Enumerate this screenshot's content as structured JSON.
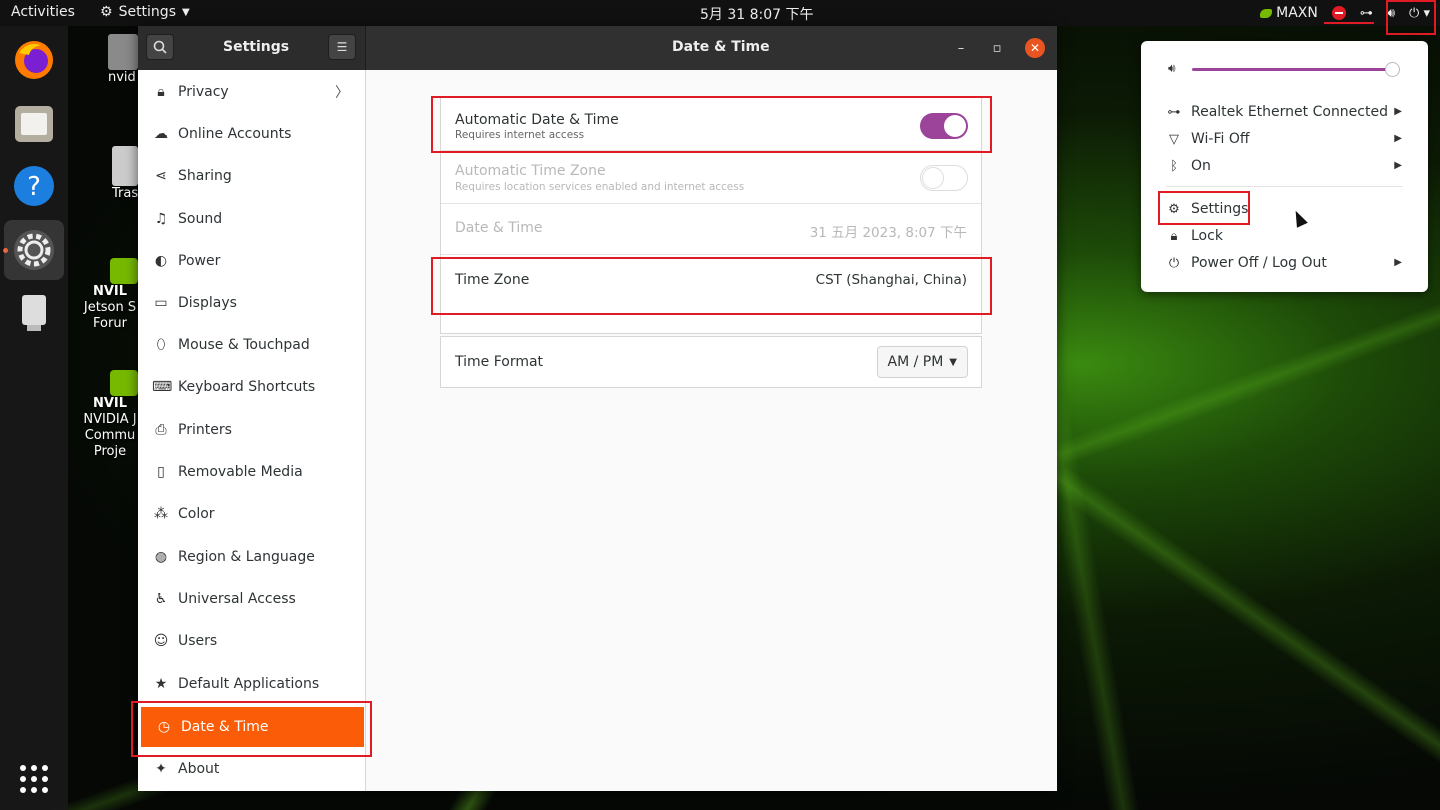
{
  "topbar": {
    "activities": "Activities",
    "app_menu": "Settings",
    "clock": "5月 31  8:07 下午",
    "power_mode": "MAXN"
  },
  "desktop": {
    "home_label": "nvid",
    "trash_label": "Tras",
    "nvidia1_label": [
      "NVIL",
      "Jetson S",
      "Forur"
    ],
    "nvidia2_label": [
      "NVIL",
      "NVIDIA J",
      "Commu",
      "Proje"
    ]
  },
  "window": {
    "sidebar_title": "Settings",
    "page_title": "Date & Time"
  },
  "sidebar": {
    "items": [
      {
        "label": "Privacy",
        "icon": "lock-icon"
      },
      {
        "label": "Online Accounts",
        "icon": "cloud-icon"
      },
      {
        "label": "Sharing",
        "icon": "share-icon"
      },
      {
        "label": "Sound",
        "icon": "music-note-icon"
      },
      {
        "label": "Power",
        "icon": "power-icon"
      },
      {
        "label": "Displays",
        "icon": "display-icon"
      },
      {
        "label": "Mouse & Touchpad",
        "icon": "mouse-icon"
      },
      {
        "label": "Keyboard Shortcuts",
        "icon": "keyboard-icon"
      },
      {
        "label": "Printers",
        "icon": "printer-icon"
      },
      {
        "label": "Removable Media",
        "icon": "media-icon"
      },
      {
        "label": "Color",
        "icon": "color-icon"
      },
      {
        "label": "Region & Language",
        "icon": "globe-icon"
      },
      {
        "label": "Universal Access",
        "icon": "accessibility-icon"
      },
      {
        "label": "Users",
        "icon": "users-icon"
      },
      {
        "label": "Default Applications",
        "icon": "star-icon"
      },
      {
        "label": "Date & Time",
        "icon": "clock-icon"
      },
      {
        "label": "About",
        "icon": "sparkle-icon"
      }
    ]
  },
  "content": {
    "auto_datetime_label": "Automatic Date & Time",
    "auto_datetime_sub": "Requires internet access",
    "auto_datetime_on": true,
    "auto_timezone_label": "Automatic Time Zone",
    "auto_timezone_sub": "Requires location services enabled and internet access",
    "auto_timezone_on": false,
    "datetime_label": "Date & Time",
    "datetime_value": "31 五月 2023,  8:07 下午",
    "timezone_label": "Time Zone",
    "timezone_value": "CST (Shanghai, China)",
    "timeformat_label": "Time Format",
    "timeformat_value": "AM / PM"
  },
  "system_menu": {
    "volume_level": 0.98,
    "ethernet": "Realtek Ethernet Connected",
    "wifi": "Wi-Fi Off",
    "bluetooth": "On",
    "settings": "Settings",
    "lock": "Lock",
    "power": "Power Off / Log Out"
  },
  "colors": {
    "accent": "#9c449a",
    "selected": "#fa5c07",
    "highlight": "#e01b24",
    "nvidia": "#76b900"
  }
}
